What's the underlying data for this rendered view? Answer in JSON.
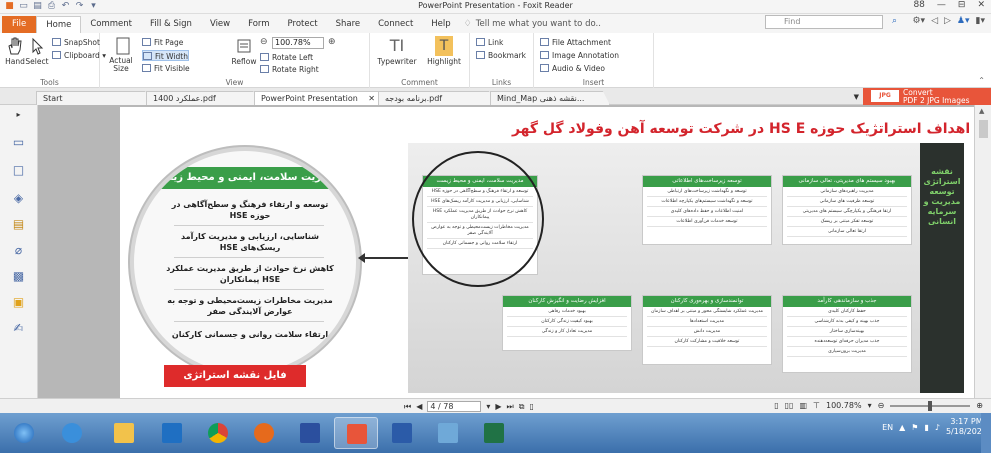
{
  "window": {
    "title": "PowerPoint Presentation - Foxit Reader",
    "controls": [
      "88",
      "—",
      "⊟",
      "✕"
    ]
  },
  "ribbon_tabs": {
    "file": "File",
    "tabs": [
      "Home",
      "Comment",
      "Fill & Sign",
      "View",
      "Form",
      "Protect",
      "Share",
      "Connect",
      "Help"
    ],
    "tell_me": "Tell me what you want to do..",
    "find_placeholder": "Find"
  },
  "ribbon": {
    "tools": {
      "label": "Tools",
      "hand": "Hand",
      "select": "Select",
      "snapshot": "SnapShot",
      "clipboard": "Clipboard"
    },
    "view": {
      "label": "View",
      "actual_size": "Actual Size",
      "fit_page": "Fit Page",
      "fit_width": "Fit Width",
      "fit_visible": "Fit Visible",
      "zoom": "100.78%",
      "reflow": "Reflow",
      "rotate_left": "Rotate Left",
      "rotate_right": "Rotate Right"
    },
    "comment": {
      "label": "Comment",
      "typewriter": "Typewriter",
      "highlight": "Highlight"
    },
    "links": {
      "label": "Links",
      "link": "Link",
      "bookmark": "Bookmark"
    },
    "insert": {
      "label": "Insert",
      "file_attachment": "File Attachment",
      "image_annotation": "Image Annotation",
      "audio_video": "Audio & Video"
    }
  },
  "doc_tabs": [
    {
      "label": "Start",
      "active": false
    },
    {
      "label": "عملکرد 1400.pdf",
      "active": false
    },
    {
      "label": "PowerPoint Presentation",
      "active": true
    },
    {
      "label": "برنامه بودجه.pdf",
      "active": false
    },
    {
      "label": "Mind_Map نقشه ذهنی...",
      "active": false
    }
  ],
  "convert": {
    "line1": "Convert",
    "line2": "PDF 2 JPG Images"
  },
  "page": {
    "heading": "– اهداف استراتژیک حوزه HS E در شرکت توسعه آهن وفولاد گل گهر",
    "magnifier": {
      "header": "مدیریت سلامت، ایمنی و محیط زیست",
      "items": [
        "توسعه و ارتقاء فرهنگ و سطح‌آگاهی در حوزه HSE",
        "شناسایی، ارزیابی و مدیریت کارآمد ریسک‌های HSE",
        "کاهش نرخ حوادث از طریق مدیریت عملکرد HSE پیمانکاران",
        "مدیریت مخاطرات زیست‌محیطی و توجه به عوارض آلایندگی صفر",
        "ارتقاء سلامت روانی و جسمانی کارکنان"
      ],
      "file_button": "فایل نقشه استراتژی"
    },
    "map": {
      "side_title": "نقشه استراتژی توسعه مدیریت و سرمایه انسانی",
      "top_boxes": [
        {
          "title": "بهبود سیستم های مدیریتی، تعالی سازمانی",
          "lines": [
            "مدیریت راهبردهای سازمانی",
            "توسعه ظرفیت های سازمانی",
            "ارتقا فرهنگی و یکپارچگی سیستم های مدیریتی",
            "توسعه تفکر مبتنی بر ریسک",
            "ارتقا تعالی سازمانی"
          ]
        },
        {
          "title": "توسعه زیرساخت‌های اطلاعاتی",
          "lines": [
            "توسعه و نگهداشت زیرساخت‌های ارتباطی",
            "توسعه و نگهداشت سیستم‌های یکپارچه اطلاعات",
            "امنیت اطلاعات و حفظ داده‌های کلیدی",
            "توسعه خدمات فن‌آوری اطلاعات"
          ]
        },
        {
          "title": "مدیریت سلامت، ایمنی و محیط زیست",
          "lines": [
            "توسعه و ارتقاء فرهنگ و سطح‌آگاهی در حوزه HSE",
            "شناسایی، ارزیابی و مدیریت کارآمد ریسک‌های HSE",
            "کاهش نرخ حوادث از طریق مدیریت عملکرد HSE پیمانکاران",
            "مدیریت مخاطرات زیست‌محیطی و توجه به عوارض آلایندگی صفر",
            "ارتقاء سلامت روانی و جسمانی کارکنان"
          ]
        }
      ],
      "bottom_boxes": [
        {
          "title": "جذب و سازماندهی کارآمد",
          "lines": [
            "حفظ کارکنان کلیدی",
            "جذب بهینه و کیفی بدنه کارشناسی",
            "بهینه‌سازی ساختار",
            "جذب مدیران حرفه‌ای توسعه‌دهنده",
            "مدیریت برون‌سپاری"
          ]
        },
        {
          "title": "توانمندسازی و بهره‌وری کارکنان",
          "lines": [
            "مدیریت عملکرد شایستگی محور و مبتنی بر اهداف سازمان",
            "مدیریت استعدادها",
            "مدیریت دانش",
            "توسعه خلاقیت و مشارکت کارکنان"
          ]
        },
        {
          "title": "افزایش رضایت و انگیزش کارکنان",
          "lines": [
            "بهبود خدمات رفاهی",
            "بهبود کیفیت زندگی کارکنان",
            "مدیریت تعادل کار و زندگی"
          ]
        }
      ]
    }
  },
  "navbar": {
    "page": "4 / 78",
    "zoom": "100.78%"
  },
  "taskbar": {
    "lang": "EN",
    "time": "3:17 PM",
    "date": "5/18/2022",
    "apps": [
      {
        "name": "start-orb",
        "color": "#2a78c9"
      },
      {
        "name": "internet-explorer",
        "color": "#3a8fdb"
      },
      {
        "name": "file-explorer",
        "color": "#f2c24b"
      },
      {
        "name": "outlook",
        "color": "#1f6fc2"
      },
      {
        "name": "chrome",
        "color": "#f4b400"
      },
      {
        "name": "firefox",
        "color": "#e66a1c"
      },
      {
        "name": "media-player",
        "color": "#2b4f9e"
      },
      {
        "name": "foxit-reader",
        "color": "#e8553a"
      },
      {
        "name": "word",
        "color": "#2b5ba8"
      },
      {
        "name": "network",
        "color": "#6fa9d8"
      },
      {
        "name": "excel",
        "color": "#207245"
      }
    ]
  },
  "colors": {
    "accent_green": "#3a9e49",
    "heading_red": "#d3242c",
    "file_orange": "#e46c24"
  }
}
